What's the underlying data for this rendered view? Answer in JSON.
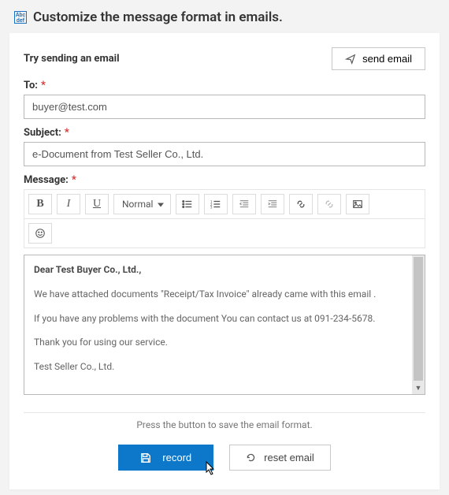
{
  "header": {
    "icon_text": "Abc\ndef",
    "title": "Customize the message format in emails."
  },
  "try_label": "Try sending an email",
  "send_button": "send email",
  "to": {
    "label": "To:",
    "value": "buyer@test.com"
  },
  "subject": {
    "label": "Subject:",
    "value": "e-Document from Test Seller Co., Ltd."
  },
  "message_label": "Message:",
  "toolbar": {
    "format_select": "Normal"
  },
  "body": {
    "greeting": "Dear Test Buyer Co., Ltd.,",
    "line1": "We have attached documents \"Receipt/Tax Invoice\" already came with this email .",
    "line2": "If you have any problems with the document You can contact us at 091-234-5678.",
    "line3": "Thank you for using our service.",
    "line4": "Test Seller Co., Ltd."
  },
  "hint": "Press the button to save the email format.",
  "record_button": "record",
  "reset_button": "reset email"
}
